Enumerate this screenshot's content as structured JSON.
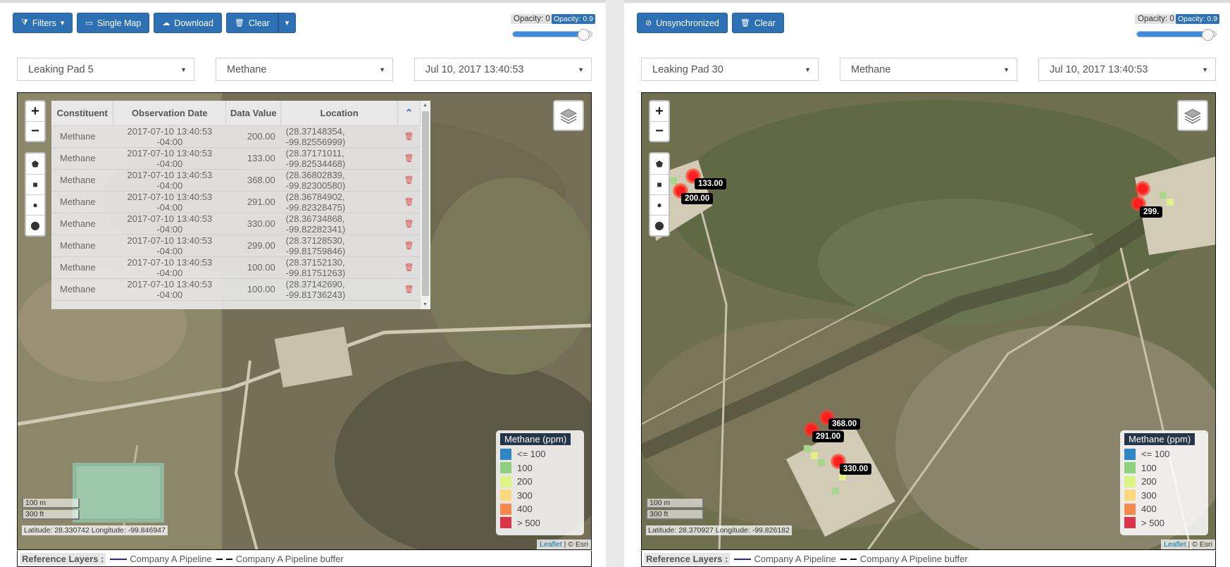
{
  "left": {
    "toolbar": {
      "filters": "Filters",
      "single_map": "Single Map",
      "download": "Download",
      "clear": "Clear"
    },
    "opacity": {
      "label": "Opacity: 0",
      "tag": "Opacity: 0.9",
      "value": 0.9
    },
    "selects": {
      "site": "Leaking Pad 5",
      "constituent": "Methane",
      "date": "Jul 10, 2017 13:40:53"
    },
    "table": {
      "headers": [
        "Constituent",
        "Observation Date",
        "Data Value",
        "Location"
      ],
      "rows": [
        {
          "constituent": "Methane",
          "date": "2017-07-10 13:40:53 -04:00",
          "value": "200.00",
          "location": "(28.37148354, -99.82556999)"
        },
        {
          "constituent": "Methane",
          "date": "2017-07-10 13:40:53 -04:00",
          "value": "133.00",
          "location": "(28.37171011, -99.82534468)"
        },
        {
          "constituent": "Methane",
          "date": "2017-07-10 13:40:53 -04:00",
          "value": "368.00",
          "location": "(28.36802839, -99.82300580)"
        },
        {
          "constituent": "Methane",
          "date": "2017-07-10 13:40:53 -04:00",
          "value": "291.00",
          "location": "(28.36784902, -99.82328475)"
        },
        {
          "constituent": "Methane",
          "date": "2017-07-10 13:40:53 -04:00",
          "value": "330.00",
          "location": "(28.36734868, -99.82282341)"
        },
        {
          "constituent": "Methane",
          "date": "2017-07-10 13:40:53 -04:00",
          "value": "299.00",
          "location": "(28.37128530, -99.81759846)"
        },
        {
          "constituent": "Methane",
          "date": "2017-07-10 13:40:53 -04:00",
          "value": "100.00",
          "location": "(28.37152130, -99.81751263)"
        },
        {
          "constituent": "Methane",
          "date": "2017-07-10 13:40:53 -04:00",
          "value": "100.00",
          "location": "(28.37142690, -99.81736243)"
        }
      ]
    },
    "coords": "Latitude: 28.330742 Longitude: -99.846947"
  },
  "right": {
    "toolbar": {
      "unsync": "Unsynchronized",
      "clear": "Clear"
    },
    "opacity": {
      "label": "Opacity: 0",
      "tag": "Opacity: 0.9",
      "value": 0.9
    },
    "selects": {
      "site": "Leaking Pad 30",
      "constituent": "Methane",
      "date": "Jul 10, 2017 13:40:53"
    },
    "markers": [
      "133.00",
      "200.00",
      "299.",
      "368.00",
      "291.00",
      "330.00"
    ],
    "coords": "Latitude: 28.370927 Longitude: -99.826182"
  },
  "map_common": {
    "scale_m": "100 m",
    "scale_ft": "300 ft",
    "attrib_leaflet": "Leaflet",
    "attrib_esri": "| © Esri",
    "legend": {
      "title": "Methane (ppm)",
      "items": [
        {
          "label": "<= 100",
          "color": "#2f86c4"
        },
        {
          "label": "100",
          "color": "#8fd07f"
        },
        {
          "label": "200",
          "color": "#def386"
        },
        {
          "label": "300",
          "color": "#fcd97c"
        },
        {
          "label": "400",
          "color": "#f8894e"
        },
        {
          "label": "> 500",
          "color": "#d9364a"
        }
      ]
    }
  },
  "reference": {
    "title": "Reference Layers :",
    "pipeline": "Company A Pipeline",
    "buffer": "Company A Pipeline buffer"
  }
}
